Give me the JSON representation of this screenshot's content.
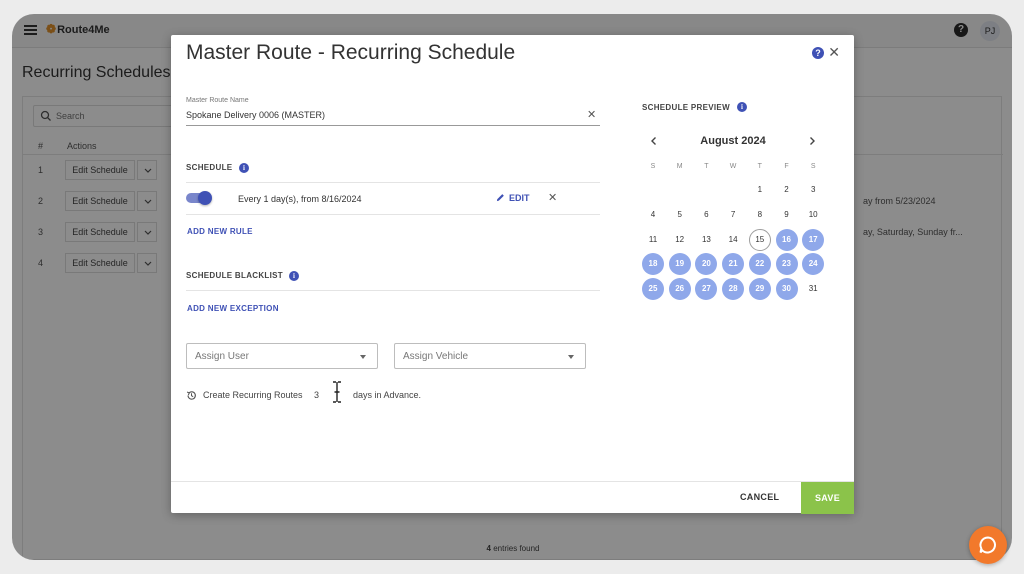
{
  "app": {
    "logo_text": "Route4Me",
    "avatar_initials": "PJ",
    "help_glyph": "?"
  },
  "background": {
    "page_title": "Recurring Schedules",
    "search_placeholder": "Search",
    "columns": {
      "num": "#",
      "actions": "Actions"
    },
    "rows": [
      {
        "num": "1",
        "action": "Edit Schedule",
        "desc": ""
      },
      {
        "num": "2",
        "action": "Edit Schedule",
        "desc": "ay from 5/23/2024"
      },
      {
        "num": "3",
        "action": "Edit Schedule",
        "desc": "ay, Saturday, Sunday fr..."
      },
      {
        "num": "4",
        "action": "Edit Schedule",
        "desc": ""
      }
    ],
    "entries_count": "4",
    "entries_label": " entries found"
  },
  "modal": {
    "title": "Master Route - Recurring Schedule",
    "name_field": {
      "label": "Master Route Name",
      "value": "Spokane Delivery 0006 (MASTER)"
    },
    "schedule": {
      "title": "SCHEDULE",
      "rule_text": "Every 1 day(s), from 8/16/2024",
      "rule_enabled": true,
      "edit_label": "EDIT",
      "add_rule_label": "ADD NEW RULE"
    },
    "blacklist": {
      "title": "SCHEDULE BLACKLIST",
      "add_exception_label": "ADD NEW EXCEPTION"
    },
    "assign_user_placeholder": "Assign User",
    "assign_vehicle_placeholder": "Assign Vehicle",
    "advance": {
      "label_before": "Create Recurring Routes",
      "days_value": "3",
      "label_after": "days in Advance."
    },
    "footer": {
      "cancel_label": "CANCEL",
      "save_label": "SAVE"
    },
    "preview": {
      "title": "SCHEDULE PREVIEW",
      "month_label": "August 2024",
      "weekdays": [
        "S",
        "M",
        "T",
        "W",
        "T",
        "F",
        "S"
      ],
      "first_weekday_index": 4,
      "days_in_month": 31,
      "today": 15,
      "scheduled_days": [
        16,
        17,
        18,
        19,
        20,
        21,
        22,
        23,
        24,
        25,
        26,
        27,
        28,
        29,
        30
      ]
    }
  },
  "colors": {
    "accent": "#3f51b5",
    "scheduled_day": "#8fa8ea",
    "save_button": "#8bc34a",
    "chat_button": "#f2792b"
  }
}
